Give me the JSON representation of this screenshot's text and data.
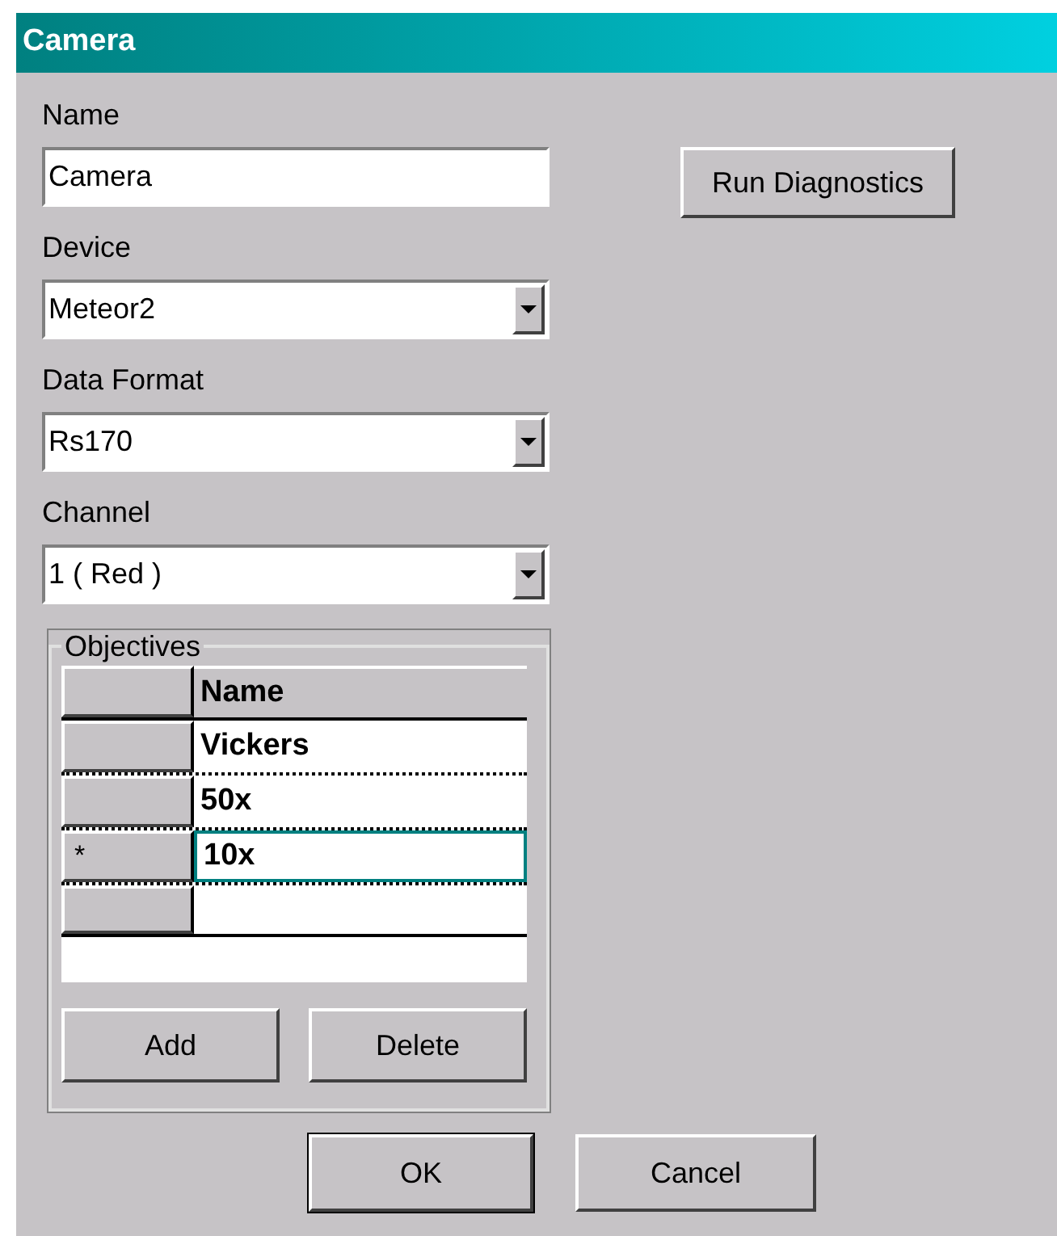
{
  "window": {
    "title": "Camera"
  },
  "name_field": {
    "label": "Name",
    "value": "Camera"
  },
  "run_diagnostics_button": "Run Diagnostics",
  "dropdowns": [
    {
      "label": "Device",
      "value": "Meteor2"
    },
    {
      "label": "Data Format",
      "value": "Rs170"
    },
    {
      "label": "Channel",
      "value": "1 ( Red )"
    }
  ],
  "objectives": {
    "title": "Objectives",
    "columns": [
      "Name"
    ],
    "rows": [
      {
        "indicator": null,
        "name": "Vickers",
        "selected": false
      },
      {
        "indicator": null,
        "name": "50x",
        "selected": false
      },
      {
        "indicator": "*",
        "name": "10x",
        "selected": true
      }
    ],
    "buttons": [
      "Add",
      "Delete"
    ]
  },
  "buttons": [
    "OK",
    "Cancel"
  ]
}
